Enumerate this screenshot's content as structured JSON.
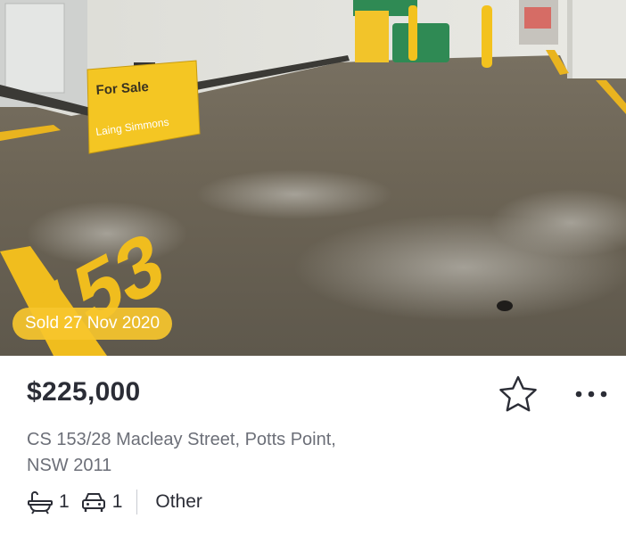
{
  "photo": {
    "sign_title": "For Sale",
    "sign_brand": "Laing Simmons",
    "floor_number": "153",
    "sold_label": "Sold 27 Nov 2020"
  },
  "listing": {
    "price": "$225,000",
    "address_line1": "CS 153/28 Macleay Street, Potts Point,",
    "address_line2": "NSW 2011",
    "bathrooms": "1",
    "car_spaces": "1",
    "property_type": "Other"
  },
  "icons": {
    "favourite": "star-outline-icon",
    "more": "more-horizontal-icon",
    "bath": "bath-icon",
    "car": "car-icon"
  },
  "colors": {
    "accent_yellow": "#f7c62c",
    "price_text": "#2b2d36",
    "address_text": "#6c6f78"
  }
}
